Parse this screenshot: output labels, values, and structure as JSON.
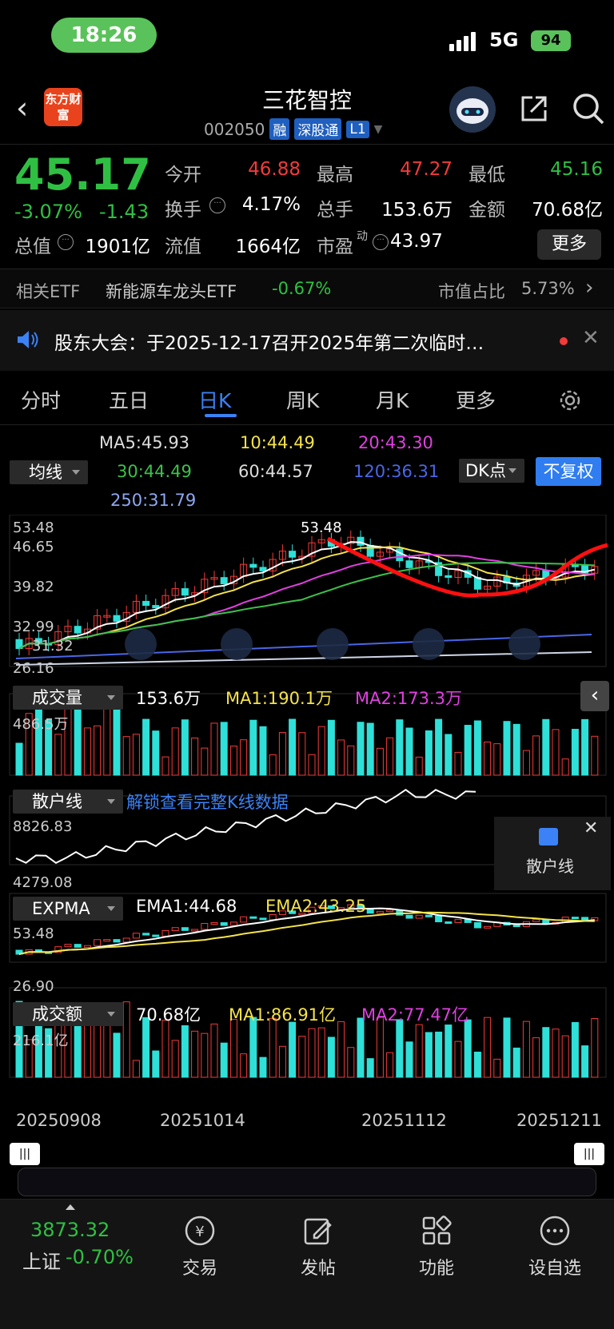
{
  "status": {
    "time": "18:26",
    "network": "5G",
    "battery": "94"
  },
  "header": {
    "title": "三花智控",
    "code": "002050",
    "tags": [
      "融",
      "深股通",
      "L1"
    ],
    "logo_text": "东方财富"
  },
  "quote": {
    "price": "45.17",
    "pct": "-3.07%",
    "chg": "-1.43",
    "stats": [
      {
        "label": "今开",
        "value": "46.88",
        "color": "#f23a3a"
      },
      {
        "label": "最高",
        "value": "47.27",
        "color": "#f23a3a"
      },
      {
        "label": "最低",
        "value": "45.16",
        "color": "#2fc043"
      },
      {
        "label": "换手",
        "value": "4.17%",
        "color": "#ffffff"
      },
      {
        "label": "总手",
        "value": "153.6万",
        "color": "#ffffff"
      },
      {
        "label": "金额",
        "value": "70.68亿",
        "color": "#ffffff"
      },
      {
        "label": "总值",
        "value": "1901亿",
        "color": "#ffffff"
      },
      {
        "label": "流值",
        "value": "1664亿",
        "color": "#ffffff"
      },
      {
        "label": "市盈",
        "value": "43.97",
        "color": "#ffffff"
      }
    ],
    "more": "更多",
    "pe_sup": "动"
  },
  "etf": {
    "label": "相关ETF",
    "name": "新能源车龙头ETF",
    "pct": "-0.67%",
    "ratio_label": "市值占比",
    "ratio": "5.73%"
  },
  "notice": {
    "text": "股东大会：于2025-12-17召开2025年第二次临时…"
  },
  "tabs": [
    "分时",
    "五日",
    "日K",
    "周K",
    "月K",
    "更多"
  ],
  "ma": {
    "select": "均线",
    "ma5": "MA5:45.93",
    "ma10": "10:44.49",
    "ma20": "20:43.30",
    "ma30": "30:44.49",
    "ma60": "60:44.57",
    "ma120": "120:36.31",
    "ma250": "250:31.79",
    "dk": "DK点",
    "fq": "不复权",
    "hi": "53.48",
    "hi_mark": "53.48",
    "y2": "46.65",
    "y3": "39.82",
    "y4": "32.99",
    "y5": "31.32",
    "lo": "26.16"
  },
  "volume": {
    "select": "成交量",
    "val": "153.6万",
    "ma1": "MA1:190.1万",
    "ma2": "MA2:173.3万",
    "max": "486.5万"
  },
  "retail": {
    "select": "散户线",
    "unlock": "解锁查看完整K线数据",
    "max": "8826.83",
    "min": "4279.08",
    "panel": "散户线"
  },
  "expma": {
    "select": "EXPMA",
    "e1": "EMA1:44.68",
    "e2": "EMA2:43.25",
    "hi": "53.48",
    "lo": "26.90"
  },
  "amount": {
    "select": "成交额",
    "val": "70.68亿",
    "ma1": "MA1:86.91亿",
    "ma2": "MA2:77.47亿",
    "max": "216.1亿"
  },
  "dates": [
    "20250908",
    "20251014",
    "20251112",
    "20251211"
  ],
  "bottom": {
    "index_val": "3873.32",
    "index_name": "上证",
    "index_pct": "-0.70%",
    "items": [
      "交易",
      "发帖",
      "功能",
      "设自选"
    ]
  },
  "colors": {
    "up": "#f23a3a",
    "down": "#2ee0d8",
    "green": "#2fc043",
    "blue": "#3b82f6"
  }
}
